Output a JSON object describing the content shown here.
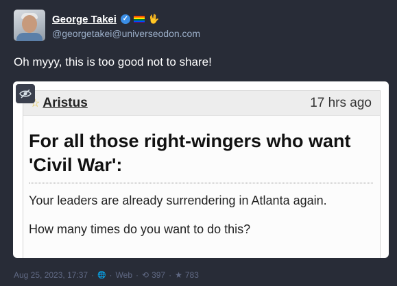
{
  "author": {
    "display_name": "George Takei",
    "handle": "@georgetakei@universeodon.com",
    "verified_glyph": "✓",
    "hand_glyph": "🖖",
    "flag_colors": [
      "#e40303",
      "#ff8c00",
      "#ffed00",
      "#008026",
      "#004dff",
      "#750787"
    ]
  },
  "status": {
    "text": "Oh myyy, this is too good not to share!"
  },
  "embedded_post": {
    "author": "Aristus",
    "time": "17 hrs ago",
    "title_line1": "For all those right-wingers who want",
    "title_line2": "'Civil War':",
    "line1": "Your leaders are already surrendering in Atlanta again.",
    "line2": "How many times do you want to do this?"
  },
  "meta": {
    "timestamp": "Aug 25, 2023, 17:37",
    "visibility_glyph": "🌐",
    "application": "Web",
    "boost_glyph": "⟲",
    "boosts": "397",
    "favourite_glyph": "★",
    "favourites": "783",
    "separator": "·"
  }
}
